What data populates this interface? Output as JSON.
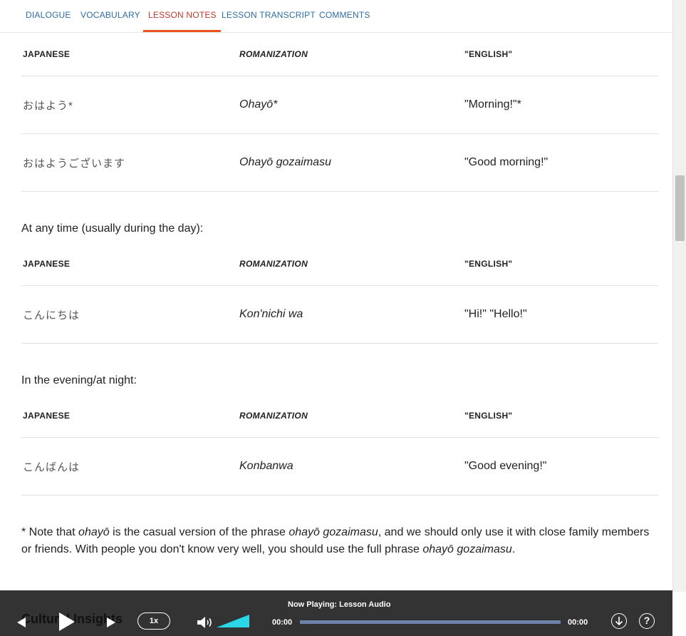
{
  "tabs": [
    {
      "label": "DIALOGUE"
    },
    {
      "label": "VOCABULARY"
    },
    {
      "label": "LESSON NOTES"
    },
    {
      "label": "LESSON TRANSCRIPT"
    },
    {
      "label": "COMMENTS"
    }
  ],
  "active_tab": "LESSON NOTES",
  "columns": {
    "japanese": "JAPANESE",
    "romanization": "ROMANIZATION",
    "english": "\"ENGLISH\""
  },
  "section1": {
    "rows": [
      {
        "japanese": "おはよう*",
        "romanization": "Ohayō*",
        "english": "\"Morning!\"*"
      },
      {
        "japanese": "おはようございます",
        "romanization": "Ohayō gozaimasu",
        "english": "\"Good morning!\""
      }
    ]
  },
  "section2": {
    "intro": "At any time (usually during the day):",
    "rows": [
      {
        "japanese": "こんにちは",
        "romanization": "Kon'nichi wa",
        "english": "\"Hi!\" \"Hello!\""
      }
    ]
  },
  "section3": {
    "intro": "In the evening/at night:",
    "rows": [
      {
        "japanese": "こんばんは",
        "romanization": "Konbanwa",
        "english": "\"Good evening!\""
      }
    ]
  },
  "note": {
    "p1": "* Note that ",
    "ohayo": "ohayō",
    "p2": " is the casual version of the phrase ",
    "ohayo_gozaimasu": "ohayō gozaimasu",
    "p3": ", and we should only use it with close family members or friends. With people you don't know very well, you should use the full phrase ",
    "ohayo_gozaimasu2": "ohayō gozaimasu",
    "p4": "."
  },
  "next_heading": "Cultural Insights",
  "player": {
    "now_playing": "Now Playing: Lesson Audio",
    "speed": "1x",
    "current_time": "00:00",
    "total_time": "00:00",
    "volume_level": 1.0,
    "progress": 0.0,
    "accent": "#2bd6e8"
  }
}
